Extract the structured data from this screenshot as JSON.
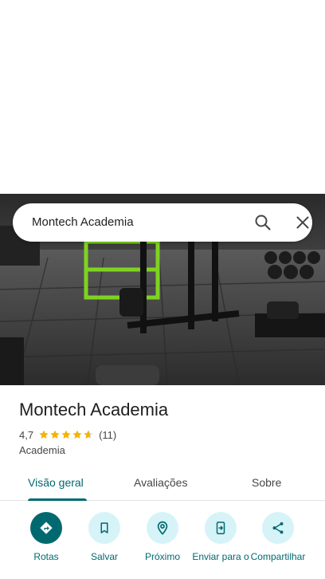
{
  "search": {
    "query": "Montech Academia",
    "search_icon": "search-icon",
    "close_icon": "close-icon"
  },
  "place": {
    "title": "Montech Academia",
    "rating": "4,7",
    "rating_stars": 4.7,
    "review_count": "(11)",
    "category": "Academia"
  },
  "tabs": [
    {
      "label": "Visão geral",
      "active": true
    },
    {
      "label": "Avaliações",
      "active": false
    },
    {
      "label": "Sobre",
      "active": false
    }
  ],
  "actions": [
    {
      "label": "Rotas",
      "icon": "directions-icon"
    },
    {
      "label": "Salvar",
      "icon": "bookmark-icon"
    },
    {
      "label": "Próximo",
      "icon": "nearby-icon"
    },
    {
      "label": "Enviar para o",
      "icon": "send-to-phone-icon"
    },
    {
      "label": "Compartilhar",
      "icon": "share-icon"
    }
  ],
  "colors": {
    "accent": "#00696f",
    "accent_light": "#d6f3f8",
    "star": "#f4b400",
    "text": "#1f1f1f",
    "secondary_text": "#444746"
  }
}
